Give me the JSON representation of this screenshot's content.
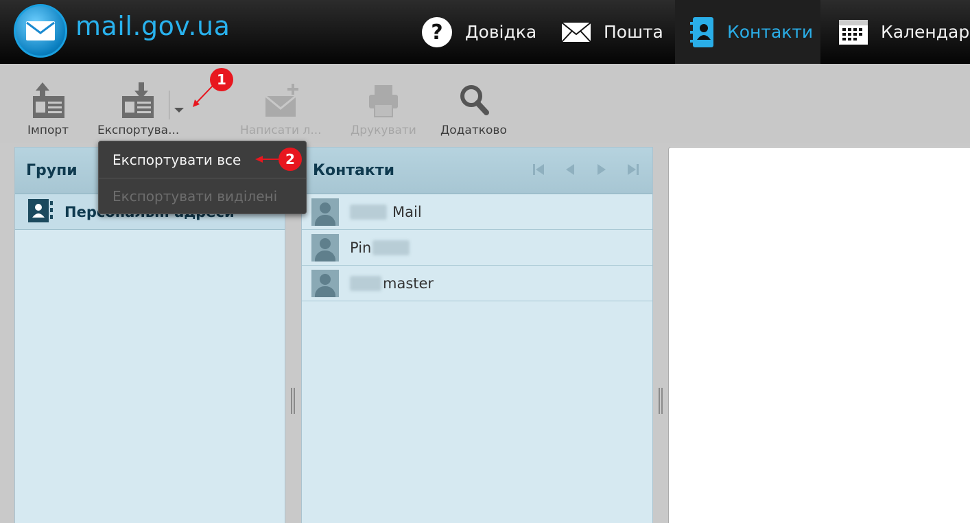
{
  "header": {
    "logo_text": "mail.gov.ua",
    "nav": [
      {
        "label": "Довідка",
        "icon": "help-icon"
      },
      {
        "label": "Пошта",
        "icon": "envelope-icon"
      },
      {
        "label": "Контакти",
        "icon": "contacts-icon",
        "active": true
      },
      {
        "label": "Календар",
        "icon": "calendar-icon"
      }
    ]
  },
  "toolbar": {
    "import_label": "Імпорт",
    "export_label": "Експортува...",
    "write_label": "Написати л...",
    "print_label": "Друкувати",
    "more_label": "Додатково"
  },
  "export_menu": {
    "items": [
      {
        "label": "Експортувати все",
        "enabled": true
      },
      {
        "label": "Експортувати виділені",
        "enabled": false
      }
    ]
  },
  "groups_panel": {
    "title": "Групи",
    "items": [
      {
        "label": "Персональні адреси"
      }
    ]
  },
  "contacts_panel": {
    "title": "Контакти",
    "contacts": [
      {
        "visible_text": "Mail"
      },
      {
        "visible_text": "Pin"
      },
      {
        "visible_text": "master"
      }
    ]
  },
  "annotations": [
    {
      "number": "1"
    },
    {
      "number": "2"
    }
  ],
  "colors": {
    "accent": "#29b2ee",
    "marker": "#e8171f",
    "panel": "#d6e9f1"
  }
}
